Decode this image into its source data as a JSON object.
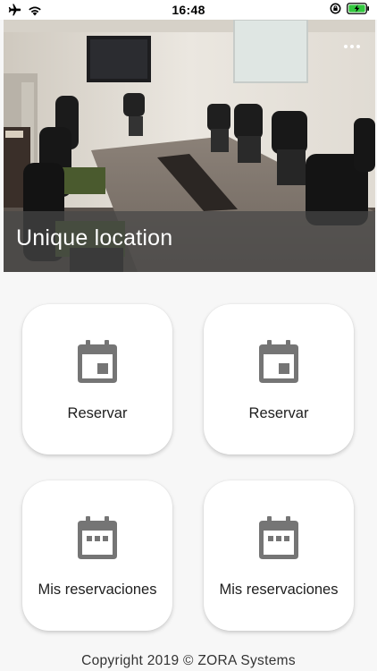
{
  "status_bar": {
    "time": "16:48",
    "left_icons": [
      "airplane-icon",
      "wifi-icon"
    ],
    "right_icons": [
      "orientation-lock-icon",
      "battery-charging-icon"
    ],
    "battery_color": "#33c83e"
  },
  "header": {
    "location_title": "Unique location",
    "menu_icon": "more-horizontal-icon"
  },
  "cards": [
    {
      "label": "Reservar",
      "icon": "calendar-event-icon"
    },
    {
      "label": "Reservar",
      "icon": "calendar-event-icon"
    },
    {
      "label": "Mis reservaciones",
      "icon": "calendar-dots-icon"
    },
    {
      "label": "Mis reservaciones",
      "icon": "calendar-dots-icon"
    }
  ],
  "footer": {
    "copyright": "Copyright 2019 © ZORA Systems"
  },
  "colors": {
    "background": "#f7f7f7",
    "card_background": "#ffffff",
    "icon_gray": "#757575",
    "title_overlay": "#464646"
  }
}
